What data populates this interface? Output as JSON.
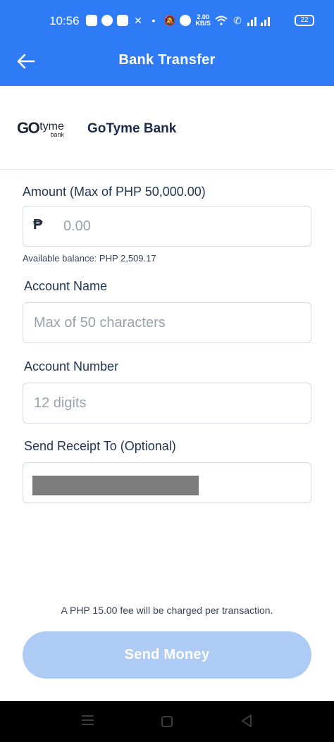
{
  "status_bar": {
    "time": "10:56",
    "net_speed_value": "2.00",
    "net_speed_unit": "KB/S",
    "battery": "22"
  },
  "header": {
    "title": "Bank Transfer",
    "background_color": "#2f7bf5"
  },
  "bank": {
    "logo_go": "GO",
    "logo_tyme": "tyme",
    "logo_bank": "bank",
    "name": "GoTyme Bank"
  },
  "form": {
    "amount_label": "Amount (Max of PHP 50,000.00)",
    "amount_currency_symbol": "₱",
    "amount_placeholder": "0.00",
    "available_balance": "Available balance: PHP 2,509.17",
    "account_name_label": "Account Name",
    "account_name_placeholder": "Max of 50 characters",
    "account_number_label": "Account Number",
    "account_number_placeholder": "12 digits",
    "receipt_label": "Send Receipt To (Optional)"
  },
  "footer": {
    "fee_note": "A PHP 15.00 fee will be charged per transaction.",
    "send_button": "Send Money",
    "button_color": "#aecbf6"
  }
}
